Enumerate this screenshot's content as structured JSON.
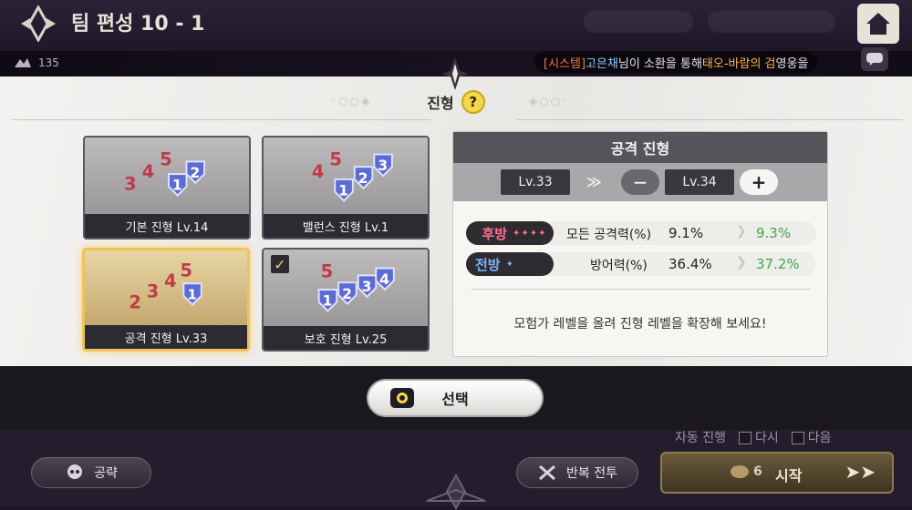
{
  "header": {
    "title": "팀 편성 10 - 1",
    "player_level": "135"
  },
  "chat": {
    "system_tag": "[시스템]",
    "user_name": "고은채",
    "text_1": "님이 소환을 통해 ",
    "item_name": "태오-바람의 검",
    "text_2": " 영웅을"
  },
  "panel": {
    "title": "진형",
    "help_label": "?"
  },
  "formations": [
    {
      "label": "기본 진형 Lv.14",
      "selected": false,
      "checked": false
    },
    {
      "label": "밸런스 진형 Lv.1",
      "selected": false,
      "checked": false
    },
    {
      "label": "공격 진형 Lv.33",
      "selected": true,
      "checked": false
    },
    {
      "label": "보호 진형 Lv.25",
      "selected": false,
      "checked": true
    }
  ],
  "detail": {
    "title": "공격 진형",
    "current_level": "Lv.33",
    "next_level": "Lv.34",
    "arrows": "≫",
    "minus_label": "−",
    "plus_label": "+",
    "stats": [
      {
        "tag": "후방",
        "stars": "✦✦✦✦",
        "name": "모든 공격력(%)",
        "value": "9.1%",
        "next": "9.3%"
      },
      {
        "tag": "전방",
        "stars": "✦",
        "name": "방어력(%)",
        "value": "36.4%",
        "next": "37.2%"
      }
    ],
    "note": "모험가 레벨을 올려 진형 레벨을 확장해 보세요!"
  },
  "select_button": {
    "label": "선택"
  },
  "footer": {
    "strategy_label": "공략",
    "repeat_label": "반복 전투",
    "auto_label": "자동 진행",
    "option_1": "다시",
    "option_2": "다음",
    "start_label": "시작",
    "cost": "6"
  },
  "colors": {
    "accent_gold": "#f0c35a",
    "rear_tag": "#ff6f8f",
    "front_tag": "#7ab4ff",
    "increase_green": "#3fa84a"
  }
}
